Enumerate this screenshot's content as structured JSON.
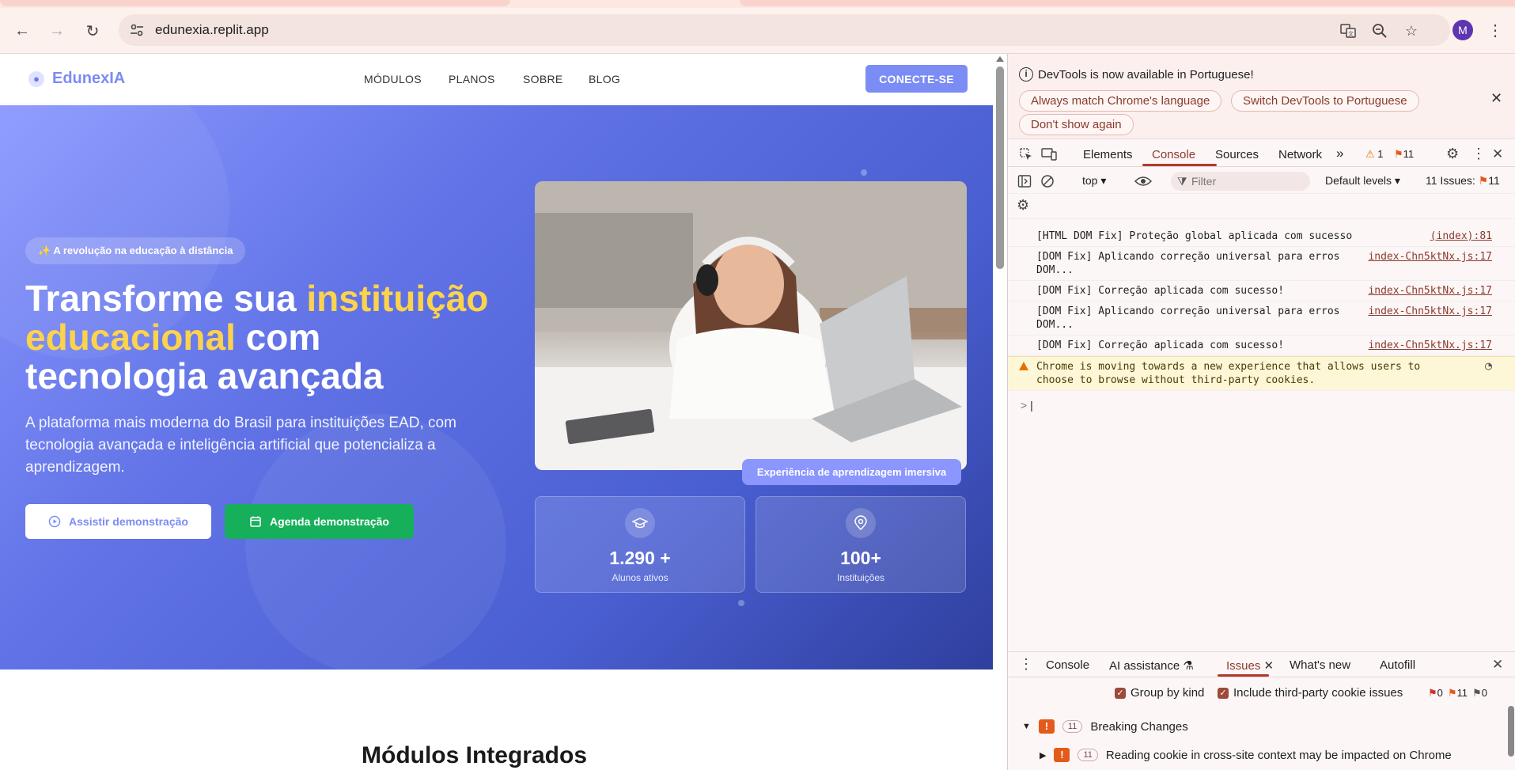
{
  "browser": {
    "url": "edunexia.replit.app",
    "avatar_letter": "M"
  },
  "site": {
    "logo_text": "EdunexIA",
    "nav": [
      "MÓDULOS",
      "PLANOS",
      "SOBRE",
      "BLOG"
    ],
    "cta_label": "CONECTE-SE",
    "badge": "✨ A revolução na educação à distância",
    "headline": {
      "part1": "Transforme sua ",
      "highlight1": "instituição",
      "highlight2": "educacional",
      "part2": " com",
      "part3": "tecnologia avançada"
    },
    "subtitle": "A plataforma mais moderna do Brasil para instituições EAD, com tecnologia avançada e inteligência artificial que potencializa a aprendizagem.",
    "btn_watch": "Assistir demonstração",
    "btn_schedule": "Agenda demonstração",
    "photo_caption": "Experiência de aprendizagem imersiva",
    "stats": [
      {
        "value": "1.290 +",
        "label": "Alunos ativos",
        "icon": "graduation-cap-icon"
      },
      {
        "value": "100+",
        "label": "Instituições",
        "icon": "map-pin-icon"
      }
    ],
    "section_title": "Módulos Integrados",
    "colors": {
      "accent": "#7b8cf5",
      "highlight": "#fcd34d",
      "green": "#16b05a"
    }
  },
  "devtools": {
    "notice": "DevTools is now available in Portuguese!",
    "pills": [
      "Always match Chrome's language",
      "Switch DevTools to Portuguese",
      "Don't show again"
    ],
    "tabs": [
      "Elements",
      "Console",
      "Sources",
      "Network"
    ],
    "warn_count": "1",
    "issue_count": "11",
    "context": "top",
    "filter_placeholder": "Filter",
    "levels": "Default levels",
    "issues_label": "11 Issues:",
    "issues_num": "11",
    "logs": [
      {
        "text": "[HTML DOM Fix] Proteção global aplicada com sucesso",
        "src": "(index):81"
      },
      {
        "text": "[DOM Fix] Aplicando correção universal para erros DOM...",
        "src": "index-Chn5ktNx.js:17"
      },
      {
        "text": "[DOM Fix] Correção aplicada com sucesso!",
        "src": "index-Chn5ktNx.js:17"
      },
      {
        "text": "[DOM Fix] Aplicando correção universal para erros DOM...",
        "src": "index-Chn5ktNx.js:17"
      },
      {
        "text": "[DOM Fix] Correção aplicada com sucesso!",
        "src": "index-Chn5ktNx.js:17"
      }
    ],
    "warning": "Chrome is moving towards a new experience that allows users to choose to browse without third-party cookies.",
    "prompt": ">",
    "drawer": {
      "tabs": [
        "Console",
        "AI assistance",
        "Issues",
        "What's new",
        "Autofill"
      ],
      "group_by_kind": "Group by kind",
      "include_third_party": "Include third-party cookie issues",
      "count_errors": "0",
      "count_warnings": "11",
      "count_info": "0",
      "group_count": "11",
      "group_title": "Breaking Changes",
      "item_count": "11",
      "item_title": "Reading cookie in cross-site context may be impacted on Chrome"
    }
  }
}
